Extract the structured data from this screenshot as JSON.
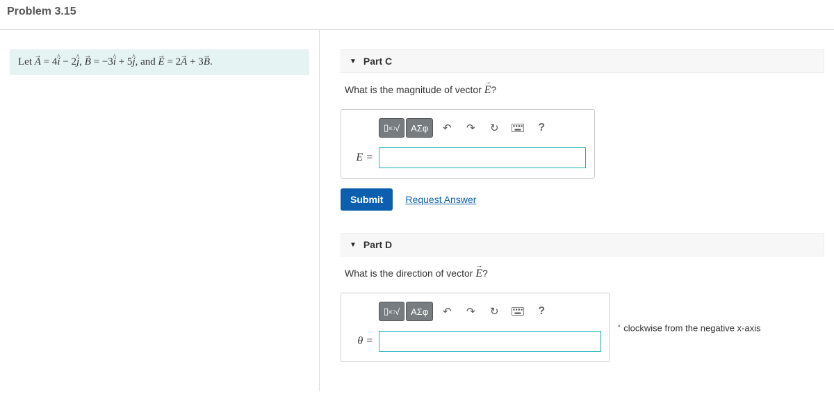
{
  "title": "Problem 3.15",
  "problem_text": "and",
  "vectors": {
    "A_label": "A",
    "A_expr": " = 4",
    "A_i": "i",
    "A_mid": " − 2",
    "A_j": "j",
    "B_label": "B",
    "B_expr": " = −3",
    "B_i": "i",
    "B_mid": " + 5",
    "B_j": "j",
    "E_label": "E",
    "E_expr": " = 2",
    "E_A": "A",
    "E_plus": " + 3",
    "E_B": "B"
  },
  "partC": {
    "title": "Part C",
    "question_pre": "What is the magnitude of vector ",
    "question_vec": "E",
    "question_post": "?",
    "lhs": "E =",
    "submit": "Submit",
    "request": "Request Answer",
    "input_value": ""
  },
  "partD": {
    "title": "Part D",
    "question_pre": "What is the direction of vector ",
    "question_vec": "E",
    "question_post": "?",
    "lhs": "θ =",
    "unit_suffix": " clockwise from the negative  x-axis",
    "input_value": ""
  },
  "toolbar": {
    "templates_icon": "▯",
    "root_icon": "√",
    "greek": "ΑΣφ",
    "undo": "↶",
    "redo": "↷",
    "reset": "↻",
    "help": "?"
  }
}
